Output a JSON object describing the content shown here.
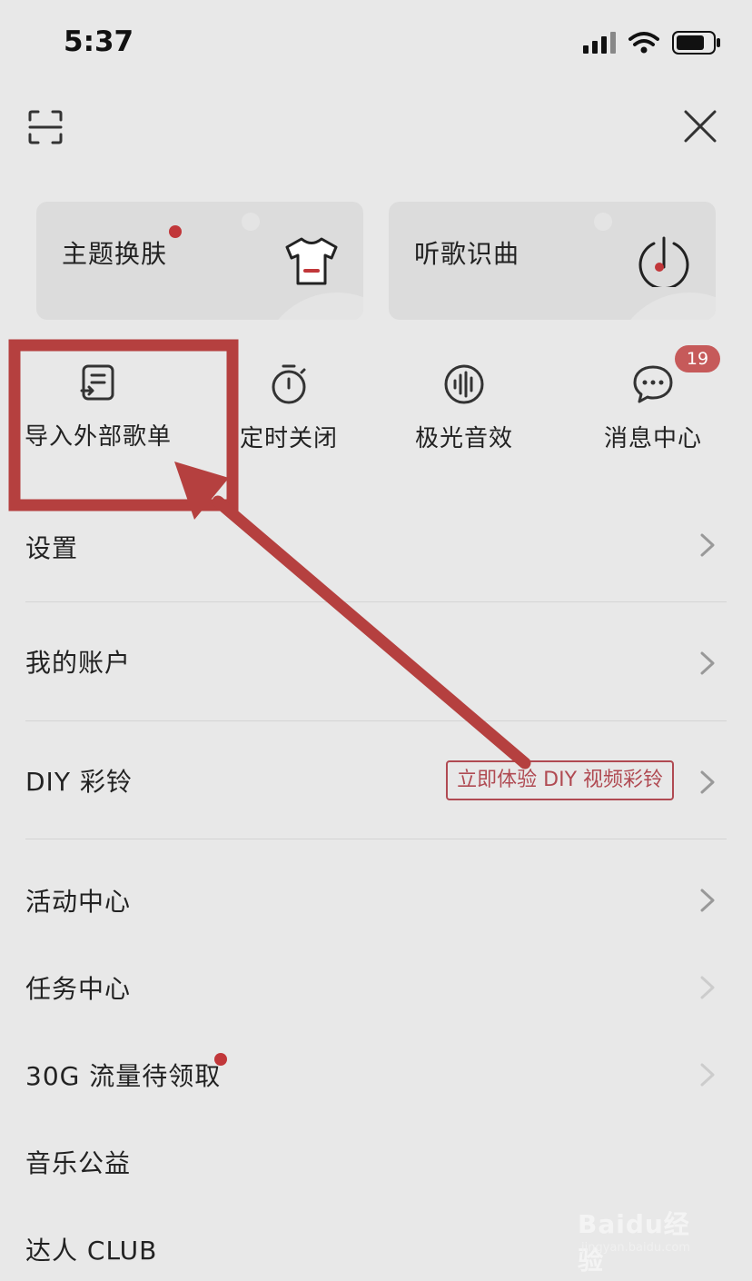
{
  "status": {
    "time": "5:37"
  },
  "cards": [
    {
      "title": "主题换肤",
      "icon": "tshirt-icon"
    },
    {
      "title": "听歌识曲",
      "icon": "music-recognize-icon"
    }
  ],
  "quick_actions": [
    {
      "label": "导入外部歌单",
      "icon": "import-list-icon"
    },
    {
      "label": "定时关闭",
      "icon": "timer-icon"
    },
    {
      "label": "极光音效",
      "icon": "sound-wave-icon"
    },
    {
      "label": "消息中心",
      "icon": "message-icon",
      "badge": "19"
    }
  ],
  "menu": [
    {
      "label": "设置"
    },
    {
      "label": "我的账户"
    },
    {
      "label": "DIY 彩铃",
      "tag": "立即体验 DIY 视频彩铃"
    },
    {
      "label": "活动中心"
    },
    {
      "label": "任务中心"
    },
    {
      "label": "30G 流量待领取"
    },
    {
      "label": "音乐公益"
    },
    {
      "label": "达人 CLUB"
    }
  ],
  "annotation": {
    "color": "#b5403f"
  },
  "colors": {
    "background": "#e8e8e8",
    "accent": "#c1373a",
    "badge": "#c65a5a"
  },
  "watermark": {
    "main": "Baidu经验",
    "sub": "jingyan.baidu.com"
  }
}
